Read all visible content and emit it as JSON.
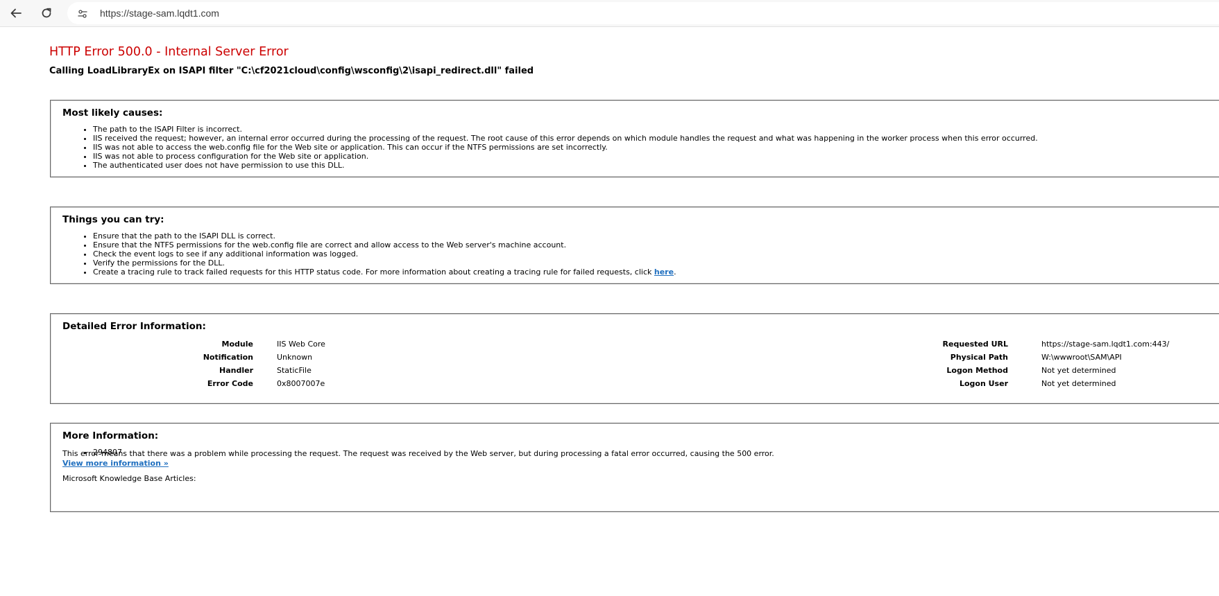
{
  "browser": {
    "url": "https://stage-sam.lqdt1.com",
    "icons": {
      "back": "arrow-left-icon",
      "reload": "reload-icon",
      "site_info": "site-settings-icon"
    }
  },
  "error": {
    "title": "HTTP Error 500.0 - Internal Server Error",
    "subtitle": "Calling LoadLibraryEx on ISAPI filter \"C:\\cf2021cloud\\config\\wsconfig\\2\\isapi_redirect.dll\" failed"
  },
  "causes": {
    "heading": "Most likely causes:",
    "items": [
      "The path to the ISAPI Filter is incorrect.",
      "IIS received the request; however, an internal error occurred during the processing of the request. The root cause of this error depends on which module handles the request and what was happening in the worker process when this error occurred.",
      "IIS was not able to access the web.config file for the Web site or application. This can occur if the NTFS permissions are set incorrectly.",
      "IIS was not able to process configuration for the Web site or application.",
      "The authenticated user does not have permission to use this DLL."
    ]
  },
  "try": {
    "heading": "Things you can try:",
    "items": [
      "Ensure that the path to the ISAPI DLL is correct.",
      "Ensure that the NTFS permissions for the web.config file are correct and allow access to the Web server's machine account.",
      "Check the event logs to see if any additional information was logged.",
      "Verify the permissions for the DLL."
    ],
    "last_item_text": "Create a tracing rule to track failed requests for this HTTP status code. For more information about creating a tracing rule for failed requests, click ",
    "last_item_link": "here",
    "last_item_end": "."
  },
  "details": {
    "heading": "Detailed Error Information:",
    "left": [
      {
        "label": "Module",
        "value": "IIS Web Core"
      },
      {
        "label": "Notification",
        "value": "Unknown"
      },
      {
        "label": "Handler",
        "value": "StaticFile"
      },
      {
        "label": "Error Code",
        "value": "0x8007007e"
      }
    ],
    "right": [
      {
        "label": "Requested URL",
        "value": "https://stage-sam.lqdt1.com:443/"
      },
      {
        "label": "Physical Path",
        "value": "W:\\wwwroot\\SAM\\API"
      },
      {
        "label": "Logon Method",
        "value": "Not yet determined"
      },
      {
        "label": "Logon User",
        "value": "Not yet determined"
      }
    ]
  },
  "more": {
    "heading": "More Information:",
    "text": "This error means that there was a problem while processing the request. The request was received by the Web server, but during processing a fatal error occurred, causing the 500 error.",
    "link": "View more information »",
    "kb_label": "Microsoft Knowledge Base Articles:",
    "kb_items": [
      "294807"
    ]
  }
}
